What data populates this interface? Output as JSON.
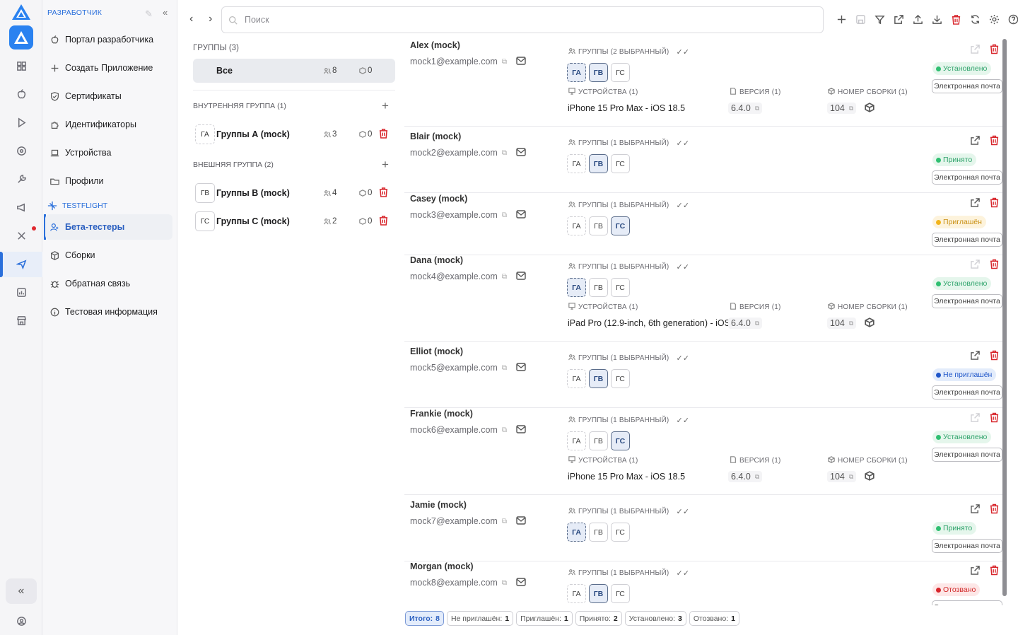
{
  "sidebar": {
    "header": "РАЗРАБОТЧИК",
    "items": [
      {
        "label": "Портал разработчика",
        "icon": "apple-icon"
      },
      {
        "label": "Создать Приложение",
        "icon": "plus-icon"
      },
      {
        "label": "Сертификаты",
        "icon": "shield-icon"
      },
      {
        "label": "Идентификаторы",
        "icon": "puzzle-icon"
      },
      {
        "label": "Устройства",
        "icon": "laptop-icon"
      },
      {
        "label": "Профили",
        "icon": "folder-icon"
      }
    ],
    "section": "TESTFLIGHT",
    "tf_items": [
      {
        "label": "Бета-тестеры",
        "icon": "users-icon",
        "active": true
      },
      {
        "label": "Сборки",
        "icon": "box-icon"
      },
      {
        "label": "Обратная связь",
        "icon": "bug-icon"
      },
      {
        "label": "Тестовая информация",
        "icon": "info-icon"
      }
    ]
  },
  "search": {
    "placeholder": "Поиск"
  },
  "groups": {
    "title": "ГРУППЫ (3)",
    "all": {
      "label": "Все",
      "testers": "8",
      "builds": "0"
    },
    "internal_title": "ВНУТРЕННЯЯ ГРУППА (1)",
    "external_title": "ВНЕШНЯЯ ГРУППА (2)",
    "internal": [
      {
        "badge": "ГА",
        "name": "Группы А (mock)",
        "testers": "3",
        "builds": "0"
      }
    ],
    "external": [
      {
        "badge": "ГВ",
        "name": "Группы В (mock)",
        "testers": "4",
        "builds": "0"
      },
      {
        "badge": "ГС",
        "name": "Группы С (mock)",
        "testers": "2",
        "builds": "0"
      }
    ]
  },
  "labels": {
    "devices": "УСТРОЙСТВА (1)",
    "version": "ВЕРСИЯ (1)",
    "build": "НОМЕР СБОРКИ (1)",
    "email_button": "Электронная почта",
    "chip_a": "ГА",
    "chip_b": "ГВ",
    "chip_c": "ГС"
  },
  "testers": [
    {
      "name": "Alex (mock)",
      "email": "mock1@example.com",
      "groups_label": "ГРУППЫ (2 ВЫБРАННЫЙ)",
      "selected": [
        "ГА",
        "ГВ"
      ],
      "status": "Установлено",
      "status_color": "green",
      "device": "iPhone 15 Pro Max - iOS 18.5",
      "version": "6.4.0",
      "build": "104"
    },
    {
      "name": "Blair (mock)",
      "email": "mock2@example.com",
      "groups_label": "ГРУППЫ (1 ВЫБРАННЫЙ)",
      "selected": [
        "ГВ"
      ],
      "status": "Принято",
      "status_color": "green"
    },
    {
      "name": "Casey (mock)",
      "email": "mock3@example.com",
      "groups_label": "ГРУППЫ (1 ВЫБРАННЫЙ)",
      "selected": [
        "ГС"
      ],
      "status": "Приглашён",
      "status_color": "yellow"
    },
    {
      "name": "Dana (mock)",
      "email": "mock4@example.com",
      "groups_label": "ГРУППЫ (1 ВЫБРАННЫЙ)",
      "selected": [
        "ГА"
      ],
      "status": "Установлено",
      "status_color": "green",
      "device": "iPad Pro (12.9-inch, 6th generation) - iOS",
      "version": "6.4.0",
      "build": "104"
    },
    {
      "name": "Elliot (mock)",
      "email": "mock5@example.com",
      "groups_label": "ГРУППЫ (1 ВЫБРАННЫЙ)",
      "selected": [
        "ГВ"
      ],
      "status": "Не приглашён",
      "status_color": "blue"
    },
    {
      "name": "Frankie (mock)",
      "email": "mock6@example.com",
      "groups_label": "ГРУППЫ (1 ВЫБРАННЫЙ)",
      "selected": [
        "ГС"
      ],
      "status": "Установлено",
      "status_color": "green",
      "device": "iPhone 15 Pro Max - iOS 18.5",
      "version": "6.4.0",
      "build": "104"
    },
    {
      "name": "Jamie (mock)",
      "email": "mock7@example.com",
      "groups_label": "ГРУППЫ (1 ВЫБРАННЫЙ)",
      "selected": [
        "ГА"
      ],
      "status": "Принято",
      "status_color": "green"
    },
    {
      "name": "Morgan (mock)",
      "email": "mock8@example.com",
      "groups_label": "ГРУППЫ (1 ВЫБРАННЫЙ)",
      "selected": [
        "ГВ"
      ],
      "status": "Отозвано",
      "status_color": "red"
    }
  ],
  "footer": [
    {
      "label": "Итого:",
      "value": "8",
      "primary": true
    },
    {
      "label": "Не приглашён:",
      "value": "1"
    },
    {
      "label": "Приглашён:",
      "value": "1"
    },
    {
      "label": "Принято:",
      "value": "2"
    },
    {
      "label": "Установлено:",
      "value": "3"
    },
    {
      "label": "Отозвано:",
      "value": "1"
    }
  ],
  "colors": {
    "accent": "#2a6fdb",
    "danger": "#d8262c",
    "installed": "#2fbf71",
    "invited": "#f2b41b"
  }
}
